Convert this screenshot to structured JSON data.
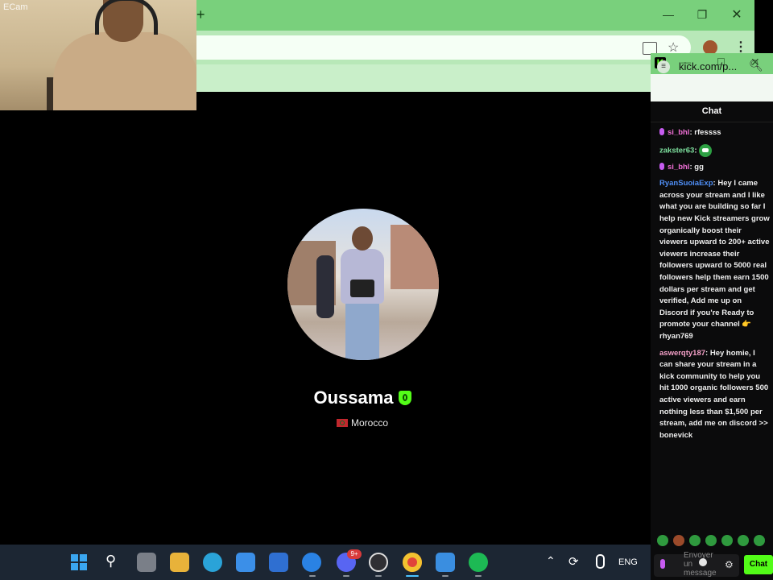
{
  "webcam": {
    "label": "ECam"
  },
  "bg_browser": {
    "new_tab": "+",
    "minimize": "—",
    "maximize": "❐",
    "close": "✕"
  },
  "profile": {
    "name": "Oussama",
    "country": "Morocco"
  },
  "kick_window": {
    "logo": "K",
    "url": "kick.com/p...",
    "chat_title": "Chat",
    "messages": [
      {
        "user": "si_bhl",
        "user_color": "#f06fd6",
        "badge": "mic-icon",
        "text": "rfessss",
        "emote": false
      },
      {
        "user": "zakster63",
        "user_color": "#7fe3a0",
        "badge": "",
        "text": "",
        "emote": true
      },
      {
        "user": "si_bhl",
        "user_color": "#f06fd6",
        "badge": "mic-icon",
        "text": "gg",
        "emote": false
      },
      {
        "user": "RyanSuoiaExp",
        "user_color": "#4f8ff7",
        "badge": "",
        "text": "Hey I came across your stream and I like what you are building so far I help new Kick streamers grow organically boost their viewers upward to 200+ active viewers increase their followers upward to 5000 real followers help them earn 1500 dollars per stream and get verified, Add me up on Discord if you're Ready to promote your channel 👉 rhyan769",
        "emote": false
      },
      {
        "user": "aswerqty187",
        "user_color": "#f5a0c8",
        "badge": "",
        "text": "Hey homie, I can share your stream in a kick community to help you hit 1000 organic followers 500 active viewers and earn nothing less than $1,500 per stream, add me on discord >> bonevick",
        "emote": false
      }
    ],
    "input_placeholder": "Envoyer un message",
    "send_label": "Chat"
  },
  "taskbar": {
    "badge_count": "9+",
    "language": "ENG"
  },
  "colors": {
    "kick_green": "#53fc18",
    "chrome_green": "#79d07c",
    "taskbar": "#1c2633"
  }
}
